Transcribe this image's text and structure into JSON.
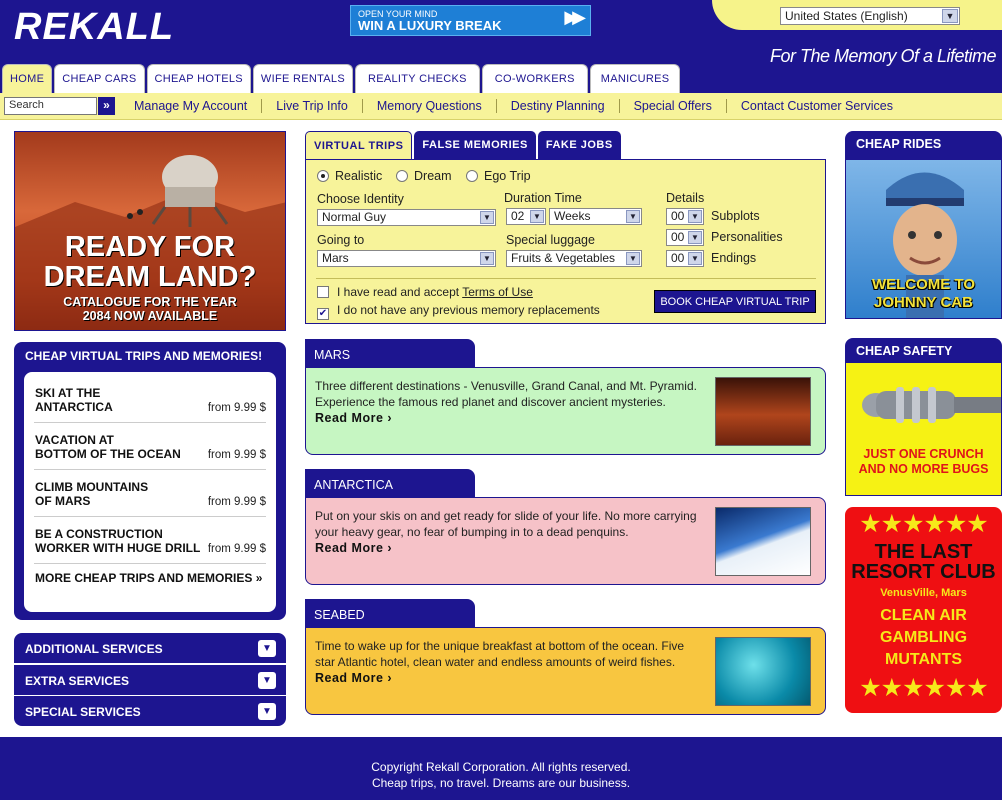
{
  "header": {
    "logo": "REKALL",
    "banner_line1": "OPEN YOUR MIND",
    "banner_line2": "WIN A LUXURY BREAK",
    "banner_arrow": "▶▶",
    "language": "United States (English)",
    "tagline": "For The Memory Of a Lifetime",
    "tabs": [
      "HOME",
      "CHEAP CARS",
      "CHEAP HOTELS",
      "WIFE RENTALS",
      "REALITY CHECKS",
      "CO-WORKERS",
      "MANICURES"
    ]
  },
  "subnav": {
    "search_value": "Search",
    "search_go": "»",
    "links": [
      "Manage My Account",
      "Live Trip Info",
      "Memory Questions",
      "Destiny Planning",
      "Special Offers",
      "Contact Customer Services"
    ]
  },
  "hero": {
    "title": "READY FOR DREAM LAND?",
    "subtitle_line1": "CATALOGUE  FOR THE YEAR",
    "subtitle_line2": "2084 NOW AVAILABLE"
  },
  "trips": {
    "heading": "CHEAP VIRTUAL TRIPS AND MEMORIES!",
    "items": [
      {
        "name1": "SKI AT THE",
        "name2": "ANTARCTICA",
        "price": "from 9.99 $"
      },
      {
        "name1": "VACATION AT",
        "name2": "BOTTOM OF THE OCEAN",
        "price": "from 9.99 $"
      },
      {
        "name1": "CLIMB MOUNTAINS",
        "name2": "OF MARS",
        "price": "from 9.99 $"
      },
      {
        "name1": "BE A CONSTRUCTION",
        "name2": "WORKER WITH HUGE DRILL",
        "price": "from 9.99 $"
      }
    ],
    "more": "MORE CHEAP TRIPS AND MEMORIES »"
  },
  "services": [
    "ADDITIONAL SERVICES",
    "EXTRA SERVICES",
    "SPECIAL SERVICES"
  ],
  "booking": {
    "tabs": [
      "VIRTUAL TRIPS",
      "FALSE MEMORIES",
      "FAKE JOBS"
    ],
    "radios": [
      "Realistic",
      "Dream",
      "Ego Trip"
    ],
    "choose_identity_label": "Choose Identity",
    "choose_identity": "Normal Guy",
    "going_to_label": "Going to",
    "going_to": "Mars",
    "duration_label": "Duration Time",
    "duration_num": "02",
    "duration_unit": "Weeks",
    "luggage_label": "Special luggage",
    "luggage": "Fruits & Vegetables",
    "details_label": "Details",
    "details": [
      {
        "num": "00",
        "label": "Subplots"
      },
      {
        "num": "00",
        "label": "Personalities"
      },
      {
        "num": "00",
        "label": "Endings"
      }
    ],
    "terms_prefix": "I have read and accept ",
    "terms_link": "Terms of Use",
    "no_previous": "I do not have any previous memory replacements",
    "book_button": "BOOK CHEAP VIRTUAL TRIP"
  },
  "destinations": [
    {
      "title": "MARS",
      "desc": "Three different destinations - Venusville, Grand Canal, and Mt. Pyramid. Experience the famous red planet and discover ancient mysteries.",
      "more": "Read More ›",
      "bg": "#c6f6c2"
    },
    {
      "title": "ANTARCTICA",
      "desc": "Put on your skis on and get ready for slide of your life. No more carrying your heavy gear, no fear of bumping in to a dead penquins.",
      "more": "Read More ›",
      "bg": "#f6c2c8"
    },
    {
      "title": "SEABED",
      "desc": "Time to wake up for the unique breakfast at bottom of the ocean. Five star Atlantic hotel, clean water and endless amounts of weird fishes.",
      "more": "Read More ›",
      "bg": "#f8c640"
    }
  ],
  "right": {
    "rides_heading": "CHEAP RIDES",
    "cab_text1": "WELCOME TO",
    "cab_text2": "JOHNNY CAB",
    "safety_heading": "CHEAP SAFETY",
    "safety_text1": "JUST ONE CRUNCH",
    "safety_text2": "AND NO MORE BUGS",
    "resort_stars": "★★★★★★",
    "resort_title1": "THE LAST",
    "resort_title2": "RESORT CLUB",
    "resort_location": "VenusVille, Mars",
    "resort_lines": [
      "CLEAN AIR",
      "GAMBLING",
      "MUTANTS"
    ]
  },
  "footer": {
    "line1": "Copyright  Rekall Corporation. All rights reserved.",
    "line2": "Cheap trips, no travel. Dreams are our  business."
  }
}
